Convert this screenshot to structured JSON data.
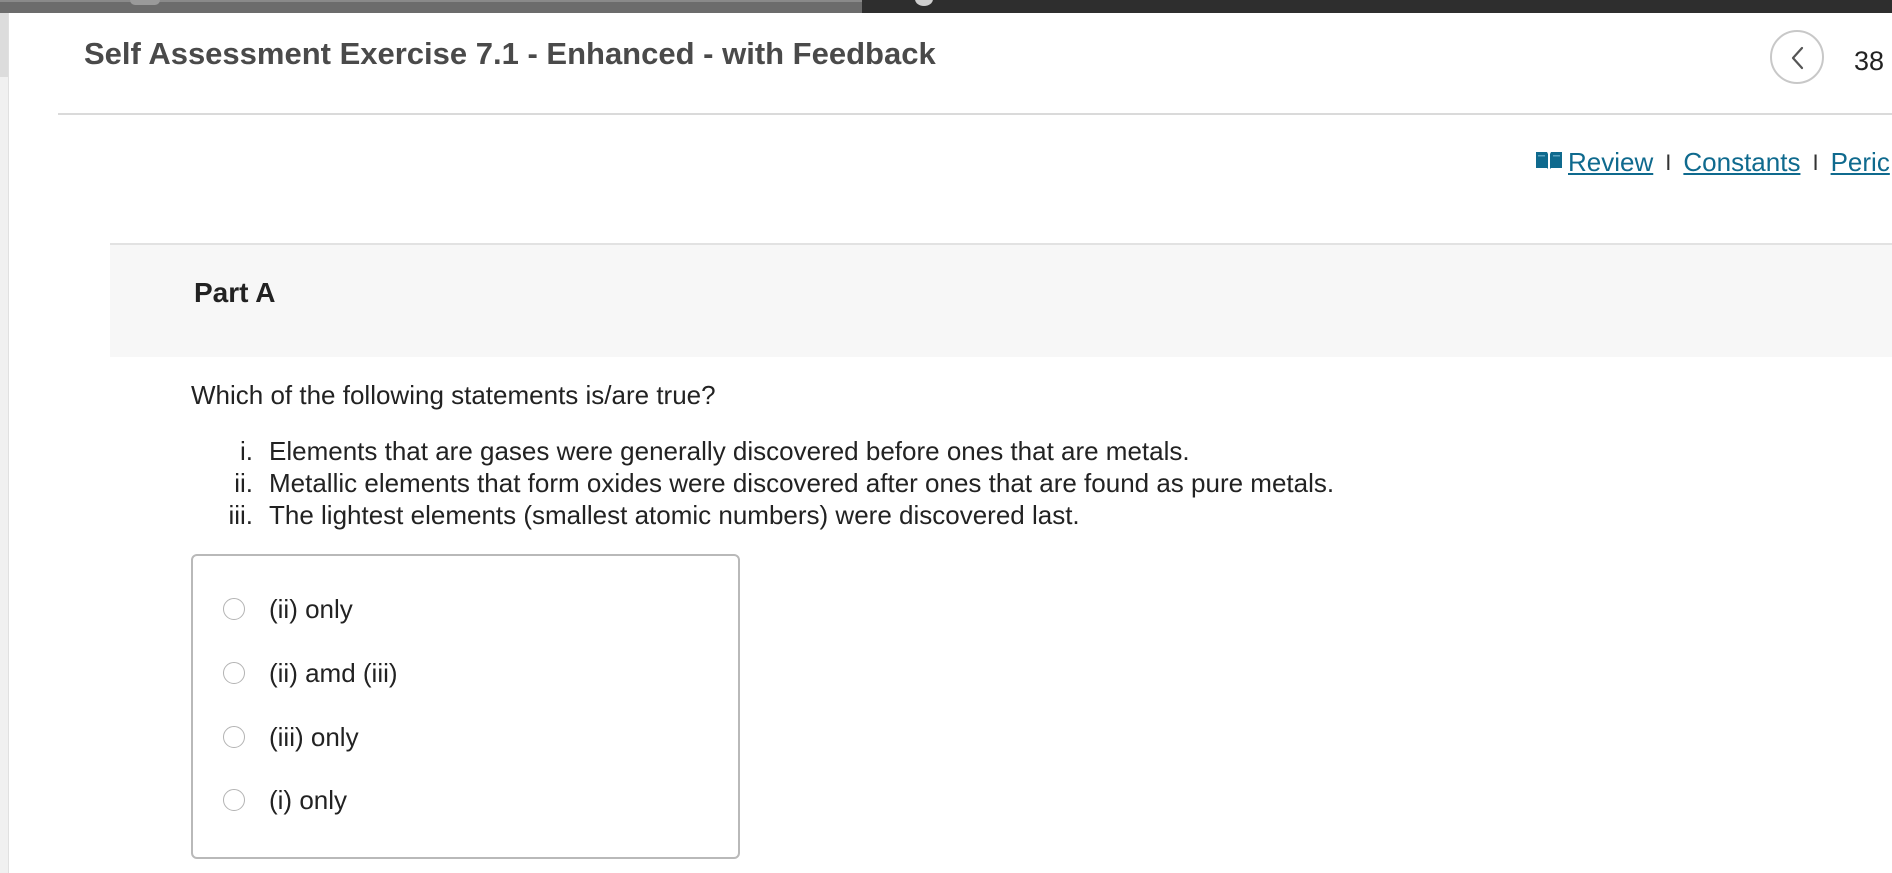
{
  "header": {
    "title": "Self Assessment Exercise 7.1 - Enhanced - with Feedback",
    "page_counter": "38"
  },
  "resources": {
    "items": [
      "Review",
      "Constants",
      "Peric"
    ],
    "separator": "I",
    "icon": "book-icon",
    "link_color": "#0f6a8e"
  },
  "part": {
    "title": "Part A",
    "expanded": true
  },
  "question": {
    "prompt": "Which of the following statements is/are true?",
    "statements": [
      {
        "num": "i.",
        "text": "Elements that are gases were generally discovered before ones that are metals."
      },
      {
        "num": "ii.",
        "text": "Metallic elements that form oxides were discovered after ones that are found as pure metals."
      },
      {
        "num": "iii.",
        "text": "The lightest elements (smallest atomic numbers) were discovered last."
      }
    ]
  },
  "answers": {
    "options": [
      "(ii) only",
      "(ii) amd (iii)",
      "(iii) only",
      "(i) only"
    ],
    "selected": null
  }
}
